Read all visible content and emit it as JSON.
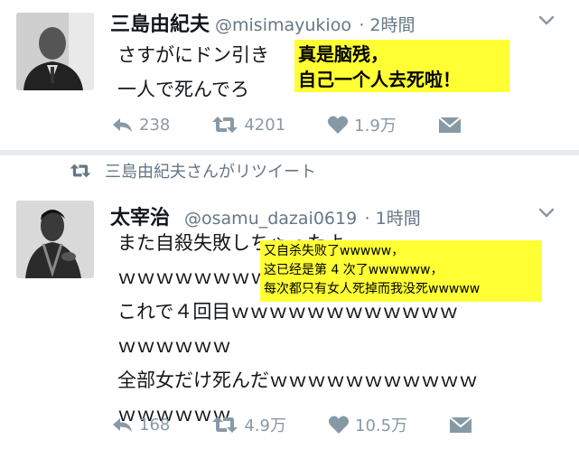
{
  "tweet1": {
    "name": "三島由紀夫",
    "handle": "@misimayukioo",
    "time": "· 2時間",
    "lines": [
      "さすがにドン引き",
      "一人で死んでろ"
    ],
    "reply_count": "238",
    "retweet_count": "4201",
    "like_count": "1.9万"
  },
  "retweet_banner": "三島由紀夫さんがリツイート",
  "tweet2": {
    "name": "太宰治",
    "handle": "@osamu_dazai0619",
    "time": "· 1時間",
    "lines": [
      "また自殺失敗しちゃったよ",
      "ｗｗｗｗｗｗｗｗ",
      "これで４回目ｗｗｗｗｗｗｗｗｗｗｗｗ",
      "ｗｗｗｗｗｗ",
      "全部女だけ死んだｗｗｗｗｗｗｗｗｗｗｗ",
      "ｗｗｗｗｗｗ"
    ],
    "reply_count": "168",
    "retweet_count": "4.9万",
    "like_count": "10.5万"
  },
  "overlay1": [
    "真是脑残，",
    "自己一个人去死啦！"
  ],
  "overlay2": [
    "又自杀失败了wwwww，",
    "这已经是第 4 次了wwwwww，",
    "每次都只有女人死掉而我没死wwwww"
  ],
  "colors": {
    "text": "#14171a",
    "meta": "#657786",
    "action": "#8899a6",
    "highlight": "#ffff33",
    "separator": "#e6ecf0"
  },
  "icons": [
    "avatar-portrait",
    "caret-down-icon",
    "reply-icon",
    "retweet-icon",
    "heart-icon",
    "dm-icon"
  ]
}
